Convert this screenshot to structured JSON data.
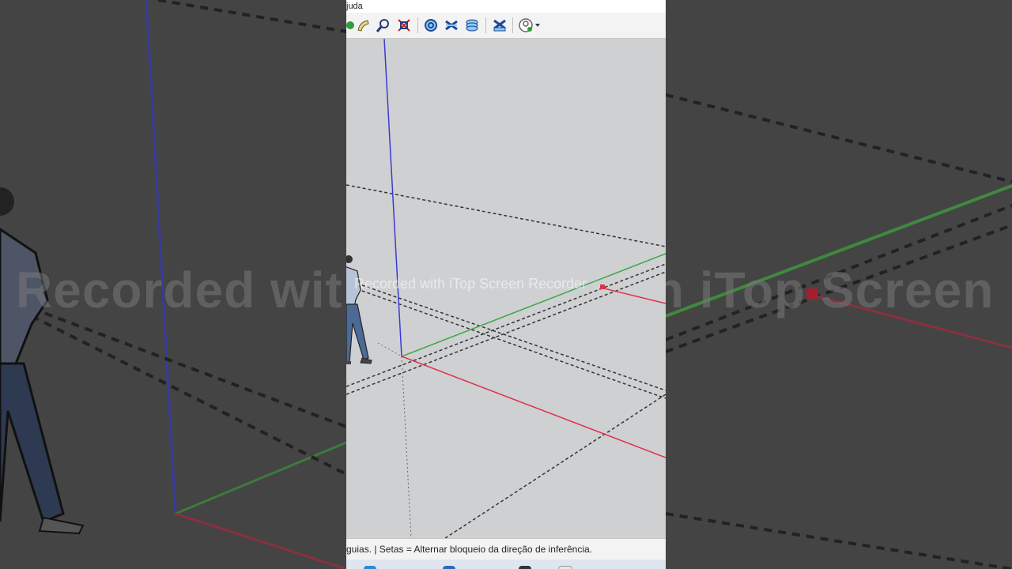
{
  "menu": {
    "visible_text": "juda"
  },
  "toolbar": {
    "buttons": [
      {
        "icon": "green-dot-icon",
        "color": "#2e9e3a"
      },
      {
        "icon": "pencil-curve-icon"
      },
      {
        "icon": "zoom-icon"
      },
      {
        "icon": "zoom-extents-icon"
      },
      {
        "icon": "section-plane-icon"
      },
      {
        "icon": "section-cut-icon"
      },
      {
        "icon": "layers-stack-icon"
      },
      {
        "icon": "section-fill-icon"
      },
      {
        "icon": "user-account-icon"
      }
    ]
  },
  "viewport": {
    "axis_colors": {
      "blue": "#3a3ad6",
      "red": "#e0304a",
      "green": "#3aa84a"
    },
    "background": "#cfd0d2",
    "watermark": "Recorded with iTop Screen Recorder"
  },
  "status": {
    "text": "guias. | Setas = Alternar bloqueio da direção de inferência."
  },
  "background_watermark": {
    "text": "Recorded with iTop Screen Recorder"
  }
}
